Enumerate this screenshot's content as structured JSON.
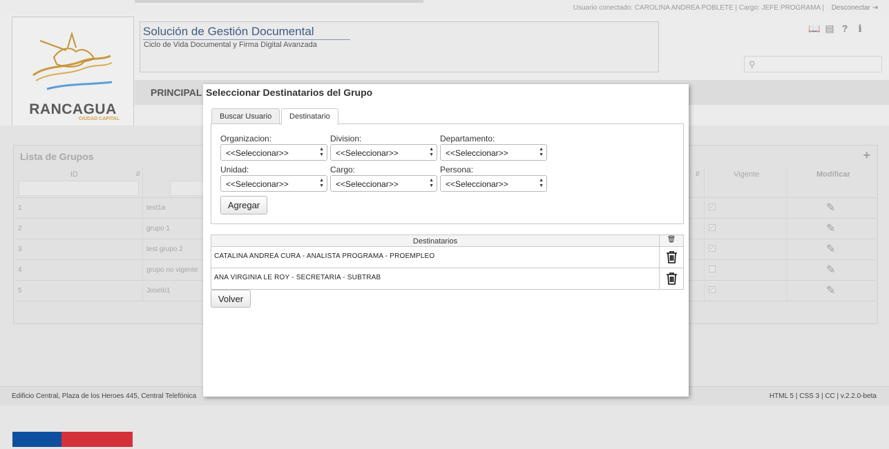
{
  "topbar": {
    "user_info": "Usuario conectado: CAROLINA ANDREA POBLETE | Cargo: JEFE PROGRAMA |",
    "logout_label": "Desconectar"
  },
  "logo": {
    "name": "RANCAGUA",
    "tagline": "CIUDAD CAPITAL"
  },
  "app": {
    "title": "Solución de Gestión Documental",
    "subtitle": "Ciclo de Vida Documental y Firma Digital Avanzada"
  },
  "header_icons": [
    "book-icon",
    "newspaper-icon",
    "help-icon",
    "info-icon"
  ],
  "nav": {
    "principal": "PRINCIPAL"
  },
  "groups": {
    "title": "Lista de Grupos",
    "col_id": "ID",
    "col_vigente": "Vigente",
    "col_modificar": "Modificar",
    "rows": [
      {
        "id": "1",
        "name": "test1a",
        "vigente": true
      },
      {
        "id": "2",
        "name": "grupo 1",
        "vigente": true
      },
      {
        "id": "3",
        "name": "test grupo 2",
        "vigente": true
      },
      {
        "id": "4",
        "name": "grupo no vigente",
        "vigente": false
      },
      {
        "id": "5",
        "name": "Joselo1",
        "vigente": true
      }
    ]
  },
  "modal": {
    "title": "Seleccionar Destinatarios del Grupo",
    "tabs": [
      "Buscar Usuario",
      "Destinatario"
    ],
    "active_tab": "Destinatario",
    "fields": [
      {
        "label": "Organizacion:",
        "value": "<<Seleccionar>>"
      },
      {
        "label": "Division:",
        "value": "<<Seleccionar>>"
      },
      {
        "label": "Departamento:",
        "value": "<<Seleccionar>>"
      },
      {
        "label": "Unidad:",
        "value": "<<Seleccionar>>"
      },
      {
        "label": "Cargo:",
        "value": "<<Seleccionar>>"
      },
      {
        "label": "Persona:",
        "value": "<<Seleccionar>>"
      }
    ],
    "add_button": "Agregar",
    "recipients_header": "Destinatarios",
    "recipients": [
      "CATALINA ANDREA CURA - ANALISTA PROGRAMA - PROEMPLEO",
      "ANA VIRGINIA LE ROY - SECRETARIA - SUBTRAB"
    ],
    "back_button": "Volver"
  },
  "footer": {
    "address": "Edificio Central, Plaza de los Heroes 445, Central Telefónica",
    "version": "HTML 5 | CSS 3 | CC | v.2.2.0-beta"
  },
  "colors": {
    "flag_blue": "#0f4fa0",
    "flag_red": "#d43139",
    "title_blue": "#3f5a85"
  }
}
